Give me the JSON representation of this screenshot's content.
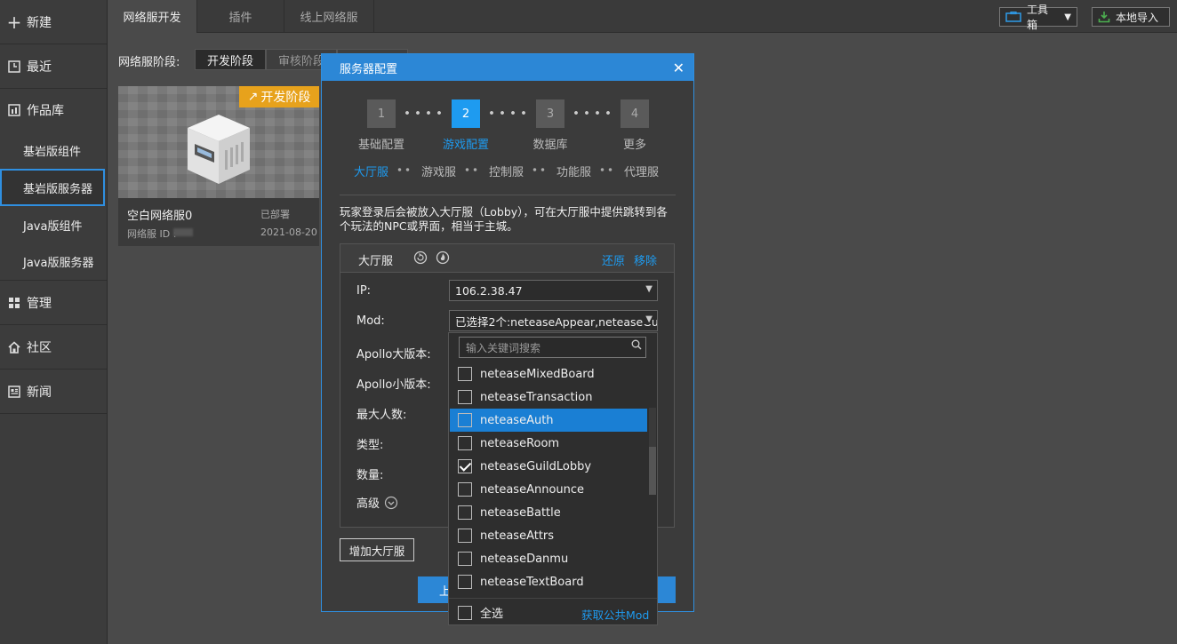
{
  "sidebar": {
    "new_label": "新建",
    "recent_label": "最近",
    "works_label": "作品库",
    "sub_items": [
      "基岩版组件",
      "基岩版服务器",
      "Java版组件",
      "Java版服务器"
    ],
    "manage_label": "管理",
    "community_label": "社区",
    "news_label": "新闻"
  },
  "topbar": {
    "tabs": [
      "网络服开发",
      "插件",
      "线上网络服"
    ],
    "toolbox_label": "工具箱",
    "import_label": "本地导入"
  },
  "stage": {
    "label": "网络服阶段:",
    "dev_label": "开发阶段",
    "review_label": "审核阶段"
  },
  "card": {
    "badge": "开发阶段",
    "name": "空白网络服0",
    "status": "已部署",
    "id_label": "网络服 ID :",
    "date": "2021-08-20"
  },
  "modal": {
    "title": "服务器配置",
    "steps": [
      {
        "num": "1",
        "label": "基础配置"
      },
      {
        "num": "2",
        "label": "游戏配置"
      },
      {
        "num": "3",
        "label": "数据库"
      },
      {
        "num": "4",
        "label": "更多"
      }
    ],
    "subtabs": [
      "大厅服",
      "游戏服",
      "控制服",
      "功能服",
      "代理服"
    ],
    "description": "玩家登录后会被放入大厅服（Lobby），可在大厅服中提供跳转到各个玩法的NPC或界面，相当于主城。",
    "panel": {
      "title": "大厅服",
      "restore_label": "还原",
      "remove_label": "移除",
      "ip_label": "IP:",
      "ip_value": "106.2.38.47",
      "mod_label": "Mod:",
      "mod_value": "已选择2个:neteaseAppear,neteaseGu",
      "apollo_major_label": "Apollo大版本:",
      "apollo_minor_label": "Apollo小版本:",
      "max_players_label": "最大人数:",
      "type_label": "类型:",
      "count_label": "数量:",
      "advanced_label": "高级"
    },
    "add_lobby_label": "增加大厅服",
    "prev_label": "上"
  },
  "dropdown": {
    "search_placeholder": "输入关键词搜索",
    "items": [
      {
        "label": "neteaseMixedBoard",
        "checked": false
      },
      {
        "label": "neteaseTransaction",
        "checked": false
      },
      {
        "label": "neteaseAuth",
        "checked": false
      },
      {
        "label": "neteaseRoom",
        "checked": false
      },
      {
        "label": "neteaseGuildLobby",
        "checked": true
      },
      {
        "label": "neteaseAnnounce",
        "checked": false
      },
      {
        "label": "neteaseBattle",
        "checked": false
      },
      {
        "label": "neteaseAttrs",
        "checked": false
      },
      {
        "label": "neteaseDanmu",
        "checked": false
      },
      {
        "label": "neteaseTextBoard",
        "checked": false
      }
    ],
    "select_all_label": "全选",
    "get_public_label": "获取公共Mod"
  },
  "colors": {
    "accent": "#1e9bf0",
    "badge": "#e7a21c",
    "header_blue": "#2c87d6"
  }
}
